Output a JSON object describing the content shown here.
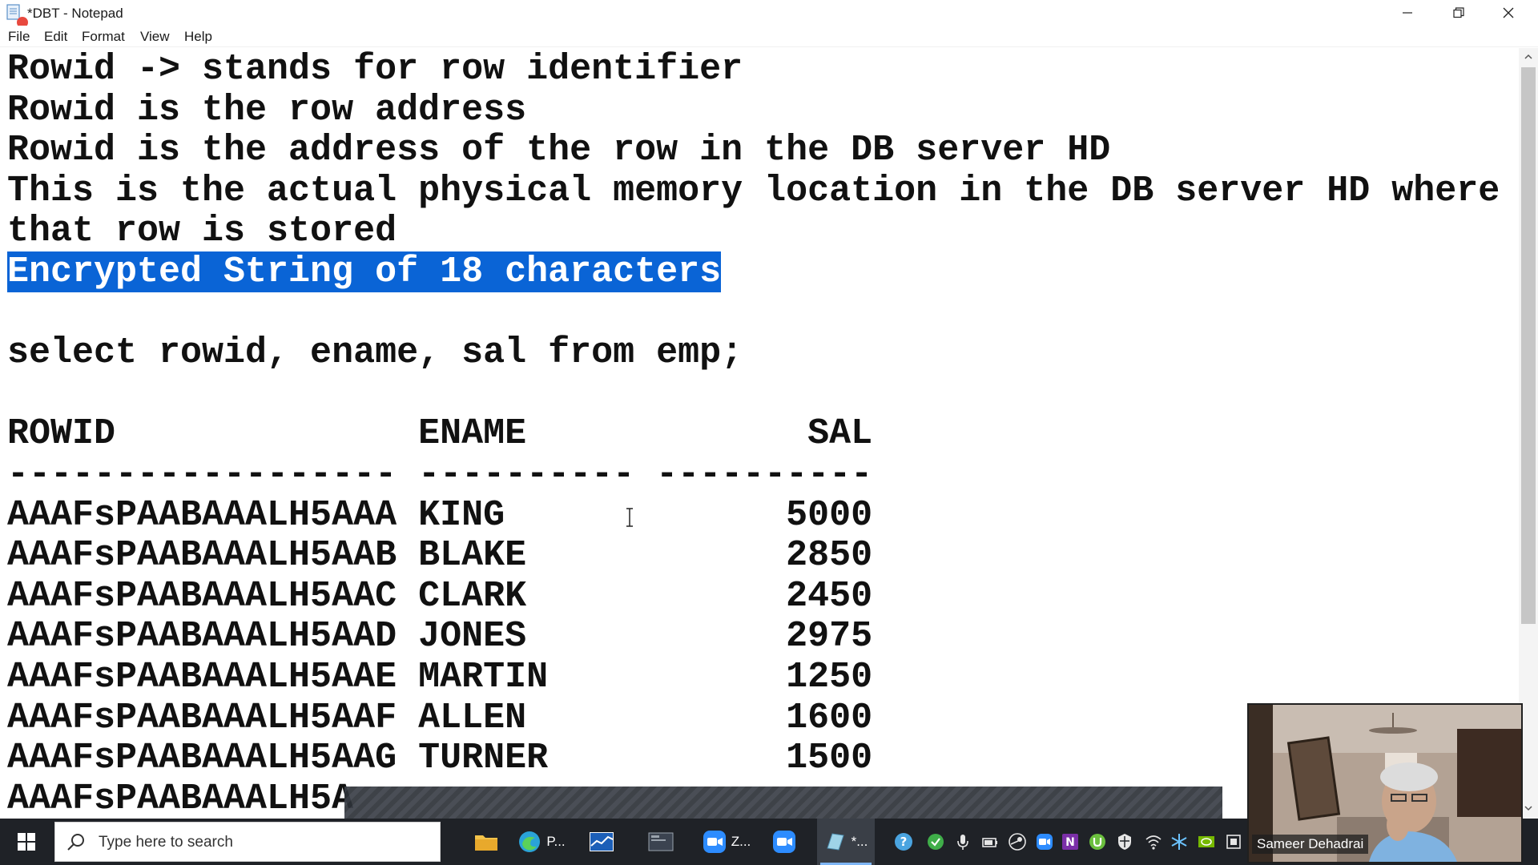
{
  "window": {
    "title": "*DBT - Notepad"
  },
  "menu": {
    "items": [
      "File",
      "Edit",
      "Format",
      "View",
      "Help"
    ]
  },
  "editor": {
    "lines": [
      "Rowid -> stands for row identifier",
      "Rowid is the row address",
      "Rowid is the address of the row in the DB server HD",
      "This is the actual physical memory location in the DB server HD where",
      "that row is stored",
      "Encrypted String of 18 characters",
      "",
      "select rowid, ename, sal from emp;",
      "",
      "ROWID              ENAME             SAL",
      "------------------ ---------- ----------",
      "AAAFsPAABAAALH5AAA KING             5000",
      "AAAFsPAABAAALH5AAB BLAKE            2850",
      "AAAFsPAABAAALH5AAC CLARK            2450",
      "AAAFsPAABAAALH5AAD JONES            2975",
      "AAAFsPAABAAALH5AAE MARTIN           1250",
      "AAAFsPAABAAALH5AAF ALLEN            1600",
      "AAAFsPAABAAALH5AAG TURNER           1500",
      "AAAFsPAABAAALH5A"
    ],
    "selected_line_index": 5
  },
  "taskbar": {
    "search_placeholder": "Type here to search",
    "apps": [
      {
        "icon": "file-explorer-icon",
        "label": ""
      },
      {
        "icon": "edge-browser-icon",
        "label": "P..."
      },
      {
        "icon": "app-chart-icon",
        "label": ""
      },
      {
        "icon": "terminal-app-icon",
        "label": ""
      },
      {
        "icon": "zoom-icon",
        "label": "Z..."
      },
      {
        "icon": "zoom-meeting-icon",
        "label": ""
      },
      {
        "icon": "notepad-icon",
        "label": "*..."
      }
    ]
  },
  "webcam": {
    "participant_name": "Sameer Dehadrai"
  },
  "colors": {
    "selection": "#0a64d6",
    "taskbar": "#1f2227",
    "text": "#111111"
  }
}
